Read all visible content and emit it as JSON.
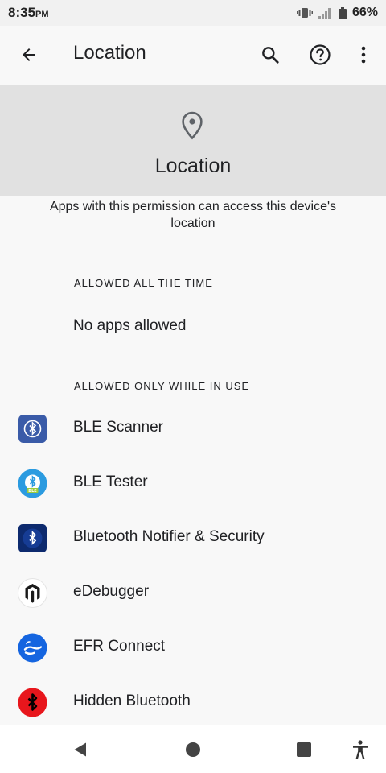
{
  "status_bar": {
    "time": "8:35",
    "ampm": "PM",
    "battery_percent": "66%"
  },
  "app_bar": {
    "title": "Location"
  },
  "hero": {
    "title": "Location"
  },
  "description": "Apps with this permission can access this device's location",
  "sections": {
    "all_the_time": {
      "header": "ALLOWED ALL THE TIME",
      "empty_text": "No apps allowed"
    },
    "while_in_use": {
      "header": "ALLOWED ONLY WHILE IN USE",
      "apps": [
        {
          "label": "BLE Scanner",
          "icon": "ble-scanner-icon"
        },
        {
          "label": "BLE Tester",
          "icon": "ble-tester-icon"
        },
        {
          "label": "Bluetooth Notifier & Security",
          "icon": "bluetooth-notifier-icon"
        },
        {
          "label": "eDebugger",
          "icon": "edebugger-icon"
        },
        {
          "label": "EFR Connect",
          "icon": "efr-connect-icon"
        },
        {
          "label": "Hidden Bluetooth",
          "icon": "hidden-bluetooth-icon"
        }
      ]
    }
  },
  "colors": {
    "hero_bg": "#e1e1e1",
    "page_bg": "#f8f8f8",
    "text": "#202124"
  }
}
